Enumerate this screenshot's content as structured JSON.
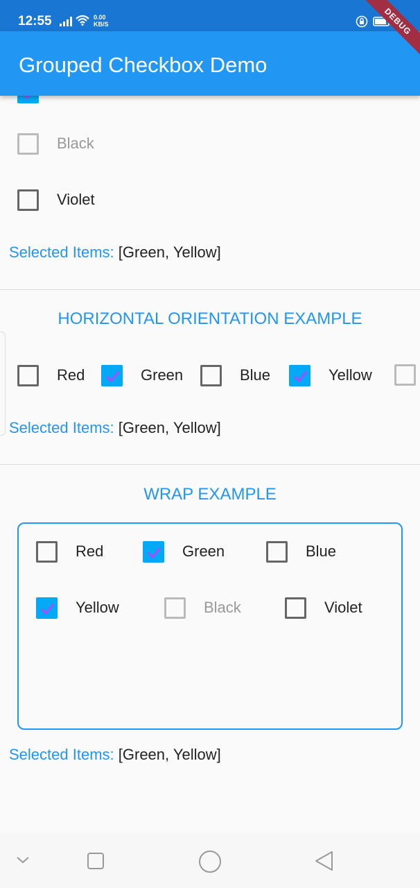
{
  "status_bar": {
    "time": "12:55",
    "net_speed_value": "0.00",
    "net_speed_unit": "KB/S"
  },
  "debug_ribbon": "DEBUG",
  "app_bar": {
    "title": "Grouped Checkbox Demo"
  },
  "vertical_example": {
    "items": [
      {
        "label": "Black",
        "checked": false,
        "disabled": true
      },
      {
        "label": "Violet",
        "checked": false,
        "disabled": false
      }
    ],
    "selected_label": "Selected Items:",
    "selected_value": "[Green, Yellow]"
  },
  "horizontal_example": {
    "title": "HORIZONTAL ORIENTATION EXAMPLE",
    "items": [
      {
        "label": "Red",
        "checked": false
      },
      {
        "label": "Green",
        "checked": true
      },
      {
        "label": "Blue",
        "checked": false
      },
      {
        "label": "Yellow",
        "checked": true
      }
    ],
    "selected_label": "Selected Items:",
    "selected_value": "[Green, Yellow]"
  },
  "wrap_example": {
    "title": "WRAP EXAMPLE",
    "items": [
      {
        "label": "Red",
        "checked": false,
        "disabled": false
      },
      {
        "label": "Green",
        "checked": true,
        "disabled": false
      },
      {
        "label": "Blue",
        "checked": false,
        "disabled": false
      },
      {
        "label": "Yellow",
        "checked": true,
        "disabled": false
      },
      {
        "label": "Black",
        "checked": false,
        "disabled": true
      },
      {
        "label": "Violet",
        "checked": false,
        "disabled": false
      }
    ],
    "selected_label": "Selected Items:",
    "selected_value": "[Green, Yellow]"
  },
  "nav_bar": {
    "buttons": [
      "chevron-down-icon",
      "recents-square-icon",
      "home-circle-icon",
      "back-triangle-icon"
    ]
  },
  "colors": {
    "app_bar": "#2196f3",
    "status_bar": "#1976d2",
    "checkbox_checked": "#03a9f4",
    "check_mark": "#a64dff",
    "accent_text": "#2196f3"
  }
}
